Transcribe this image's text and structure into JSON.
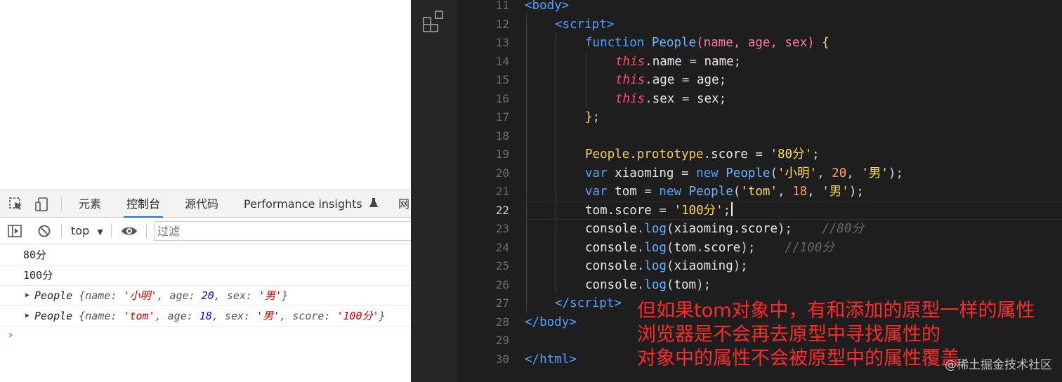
{
  "devtools": {
    "tabs": [
      "元素",
      "控制台",
      "源代码",
      "Performance insights",
      "网"
    ],
    "context": "top",
    "filter_placeholder": "过滤",
    "console": {
      "line1": "80分",
      "line2": "100分",
      "obj1": {
        "cls": "People",
        "name_val": "'小明'",
        "age_val": "20",
        "sex_val": "'男'"
      },
      "obj2": {
        "cls": "People",
        "name_val": "'tom'",
        "age_val": "18",
        "sex_val": "'男'",
        "score_val": "'100分'"
      }
    }
  },
  "editor": {
    "line_numbers": [
      "11",
      "12",
      "13",
      "14",
      "15",
      "16",
      "17",
      "18",
      "19",
      "20",
      "21",
      "22",
      "23",
      "24",
      "25",
      "26",
      "27",
      "28",
      "29",
      "30"
    ],
    "current_line": "22",
    "strings": {
      "s80": "'80分'",
      "sxm": "'小明'",
      "snan": "'男'",
      "stom": "'tom'",
      "s100": "'100分'"
    },
    "comments": {
      "c23": "//80分",
      "c24": "//100分"
    }
  },
  "annotation": {
    "lines": [
      "但如果tom对象中，有和添加的原型一样的属性",
      "浏览器是不会再去原型中寻找属性的",
      "对象中的属性不会被原型中的属性覆盖"
    ]
  },
  "watermark": "@稀土掘金技术社区"
}
